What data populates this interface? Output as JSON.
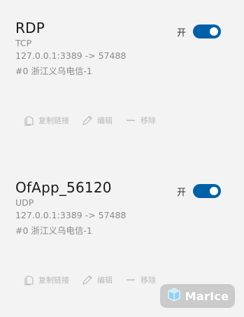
{
  "tunnels": [
    {
      "name": "RDP",
      "protocol": "TCP",
      "mapping": "127.0.0.1:3389 -> 57488",
      "node": "#0 浙江义乌电信-1",
      "toggle_label": "开",
      "enabled": true
    },
    {
      "name": "OfApp_56120",
      "protocol": "UDP",
      "mapping": "127.0.0.1:3389 -> 57488",
      "node": "#0 浙江义乌电信-1",
      "toggle_label": "开",
      "enabled": true
    }
  ],
  "actions": {
    "copy_label": "复制链接",
    "edit_label": "编辑",
    "remove_label": "移除"
  },
  "watermark": {
    "text": "MarIce",
    "icon": "ice-cube-icon"
  },
  "colors": {
    "toggle_on": "#0060a8",
    "background": "#f3f3f3",
    "muted_text": "#8a8a8a",
    "action_text": "#b8b8b8"
  }
}
